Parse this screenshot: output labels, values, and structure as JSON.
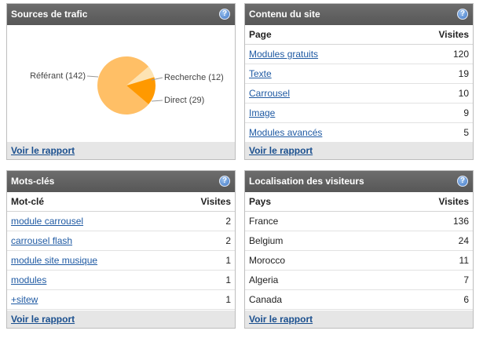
{
  "traffic": {
    "title": "Sources de trafic",
    "help": "?",
    "report_link": "Voir le rapport",
    "chart_data": {
      "type": "pie",
      "title": "",
      "categories": [
        "Référant",
        "Recherche",
        "Direct"
      ],
      "values": [
        142,
        12,
        29
      ],
      "labels": [
        "Référant (142)",
        "Recherche (12)",
        "Direct (29)"
      ],
      "colors": [
        "#ffbf66",
        "#fde3b3",
        "#ff9900"
      ]
    }
  },
  "content": {
    "title": "Contenu du site",
    "help": "?",
    "col_page": "Page",
    "col_visits": "Visites",
    "rows": [
      {
        "name": "Modules gratuits",
        "value": "120"
      },
      {
        "name": "Texte",
        "value": "19"
      },
      {
        "name": "Carrousel",
        "value": "10"
      },
      {
        "name": "Image",
        "value": "9"
      },
      {
        "name": "Modules avancés",
        "value": "5"
      }
    ],
    "report_link": "Voir le rapport"
  },
  "keywords": {
    "title": "Mots-clés",
    "help": "?",
    "col_keyword": "Mot-clé",
    "col_visits": "Visites",
    "rows": [
      {
        "name": "module carrousel",
        "value": "2"
      },
      {
        "name": "carrousel flash",
        "value": "2"
      },
      {
        "name": "module site musique",
        "value": "1"
      },
      {
        "name": "modules",
        "value": "1"
      },
      {
        "name": "+sitew",
        "value": "1"
      }
    ],
    "report_link": "Voir le rapport"
  },
  "geo": {
    "title": "Localisation des visiteurs",
    "help": "?",
    "col_country": "Pays",
    "col_visits": "Visites",
    "rows": [
      {
        "name": "France",
        "value": "136"
      },
      {
        "name": "Belgium",
        "value": "24"
      },
      {
        "name": "Morocco",
        "value": "11"
      },
      {
        "name": "Algeria",
        "value": "7"
      },
      {
        "name": "Canada",
        "value": "6"
      }
    ],
    "report_link": "Voir le rapport"
  }
}
